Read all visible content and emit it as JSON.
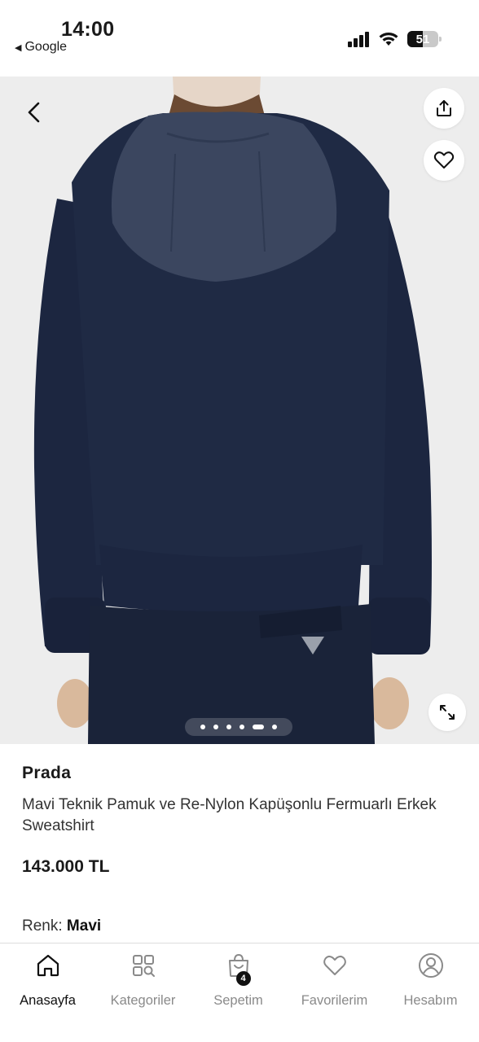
{
  "status_bar": {
    "time": "14:00",
    "back_app": "Google",
    "battery_percent": "51"
  },
  "gallery": {
    "image_count": 6,
    "active_index": 4,
    "icons": {
      "back": "chevron-left-icon",
      "share": "share-icon",
      "favorite": "heart-icon",
      "expand": "expand-icon"
    }
  },
  "product": {
    "brand": "Prada",
    "title": "Mavi Teknik Pamuk ve Re-Nylon Kapüşonlu Fermuarlı Erkek Sweatshirt",
    "price": "143.000 TL",
    "color_label": "Renk:",
    "color_value": "Mavi"
  },
  "tabbar": {
    "tabs": [
      {
        "label": "Anasayfa",
        "icon": "home-icon",
        "active": true
      },
      {
        "label": "Kategoriler",
        "icon": "categories-icon",
        "active": false
      },
      {
        "label": "Sepetim",
        "icon": "bag-icon",
        "active": false,
        "badge": "4"
      },
      {
        "label": "Favorilerim",
        "icon": "heart-icon",
        "active": false
      },
      {
        "label": "Hesabım",
        "icon": "user-icon",
        "active": false
      }
    ]
  },
  "colors": {
    "jacket_navy": "#1f2a44",
    "hood_navy": "#3b465f",
    "background_grey": "#ededed",
    "active_tab": "#111111",
    "inactive_tab": "#8a8a8a"
  }
}
